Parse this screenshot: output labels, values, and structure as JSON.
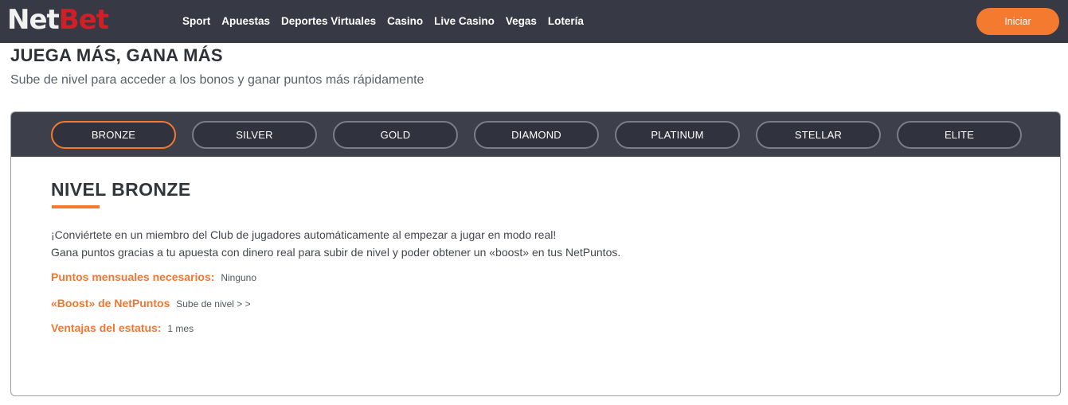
{
  "header": {
    "logo": {
      "net": "Net",
      "bet": "Bet"
    },
    "nav": [
      "Sport",
      "Apuestas",
      "Deportes Virtuales",
      "Casino",
      "Live Casino",
      "Vegas",
      "Lotería"
    ],
    "login_label": "Iniciar"
  },
  "page": {
    "title": "JUEGA MÁS, GANA MÁS",
    "subtitle": "Sube de nivel para acceder a los bonos y ganar puntos más rápidamente"
  },
  "tabs": [
    "BRONZE",
    "SILVER",
    "GOLD",
    "DIAMOND",
    "PLATINUM",
    "STELLAR",
    "ELITE"
  ],
  "active_tab": "BRONZE",
  "level": {
    "title": "NIVEL BRONZE",
    "desc_line1": "¡Conviértete en un miembro del Club de jugadores automáticamente al empezar a jugar en modo real!",
    "desc_line2": "Gana puntos gracias a tu apuesta con dinero real para subir de nivel y poder obtener un «boost» en tus NetPuntos.",
    "points_label": "Puntos mensuales necesarios:",
    "points_value": "Ninguno",
    "boost_label": "«Boost» de NetPuntos",
    "boost_value": "Sube de nivel > >",
    "status_label": "Ventajas del estatus:",
    "status_value": "1 mes"
  },
  "colors": {
    "accent": "#f47a30",
    "header_bg": "#373a45",
    "tab_bg": "#3d404b",
    "logo_red": "#d01f26"
  }
}
